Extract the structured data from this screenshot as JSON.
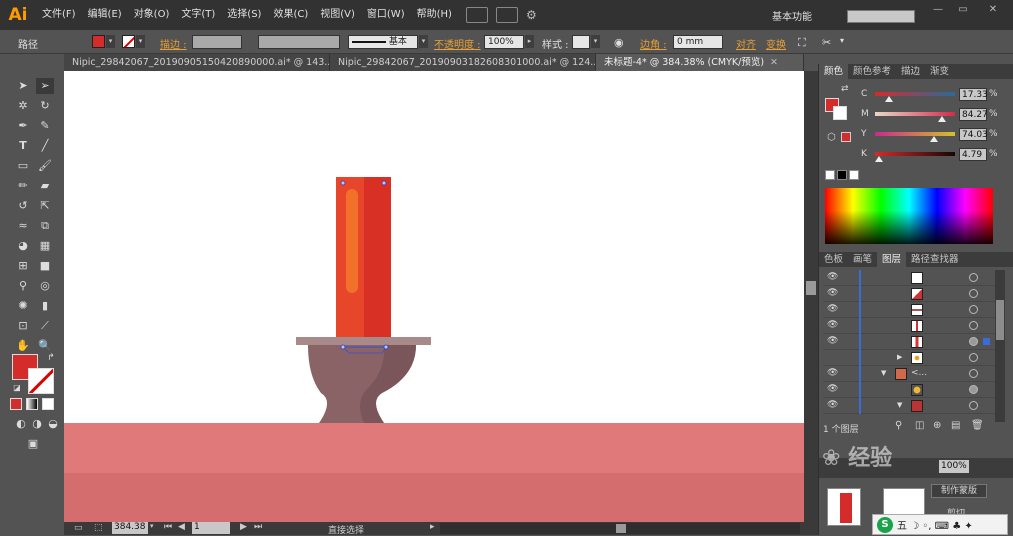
{
  "app": {
    "logo": "Ai",
    "menus": [
      "文件(F)",
      "编辑(E)",
      "对象(O)",
      "文字(T)",
      "选择(S)",
      "效果(C)",
      "视图(V)",
      "窗口(W)",
      "帮助(H)"
    ],
    "workspace": "基本功能",
    "window_controls": [
      "—",
      "▭",
      "✕"
    ]
  },
  "control_bar": {
    "selection_label": "路径",
    "stroke_label": "描边 :",
    "stroke_style": "基本",
    "opacity_label": "不透明度 :",
    "opacity_value": "100%",
    "style_label": "样式 :",
    "corner_label": "边角 :",
    "corner_value": "0 mm",
    "align_label": "对齐",
    "transform_label": "变换"
  },
  "tabs": [
    {
      "label": "Nipic_29842067_20190905150420890000.ai* @ 143...",
      "active": false
    },
    {
      "label": "Nipic_29842067_20190903182608301000.ai* @ 124...",
      "active": false
    },
    {
      "label": "未标题-4* @ 384.38% (CMYK/预览)",
      "active": true
    }
  ],
  "tab_close": "✕",
  "status_bar": {
    "zoom": "384.38",
    "page": "1",
    "tool": "直接选择"
  },
  "color_panel": {
    "tabs": [
      "颜色",
      "颜色参考",
      "描边",
      "渐变"
    ],
    "channels": [
      {
        "name": "C",
        "value": "17.33",
        "fraction": 0.17
      },
      {
        "name": "M",
        "value": "84.27",
        "fraction": 0.84
      },
      {
        "name": "Y",
        "value": "74.03",
        "fraction": 0.74
      },
      {
        "name": "K",
        "value": "4.79",
        "fraction": 0.05
      }
    ],
    "pct": "%",
    "fill_color": "#d42b2b"
  },
  "layers_panel": {
    "tabs": [
      "色板",
      "画笔",
      "图层",
      "路径查找器"
    ],
    "footer": "1 个图层",
    "row_label": "<..."
  },
  "colors": {
    "candle_main": "#d93025",
    "candle_light": "#e8462a",
    "candle_highlight": "#f2702a",
    "holder_plate": "#a98a8a",
    "holder_body": "#8a6367",
    "holder_shade": "#7a555a",
    "table_top": "#e07a7a",
    "table_front": "#d46d6d"
  },
  "taskbar": {
    "ime": "S",
    "chars": "五 ☽ ◦, ⌨ ♣ ✦"
  },
  "bottom_panel": {
    "button": "制作蒙版",
    "clip": "剪切"
  }
}
